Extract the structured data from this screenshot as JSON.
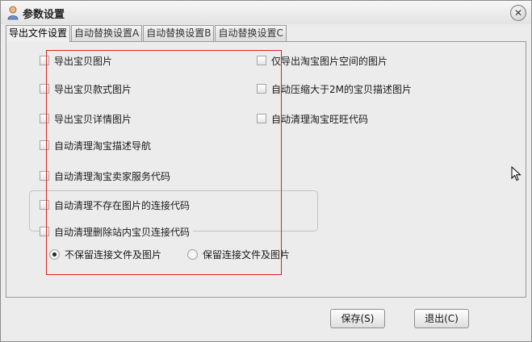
{
  "window": {
    "title": "参数设置",
    "close_glyph": "✕"
  },
  "tabs": [
    {
      "label": "导出文件设置",
      "active": true
    },
    {
      "label": "自动替换设置A",
      "active": false
    },
    {
      "label": "自动替换设置B",
      "active": false
    },
    {
      "label": "自动替换设置C",
      "active": false
    }
  ],
  "options": {
    "left": [
      {
        "label": "导出宝贝图片",
        "checked": false
      },
      {
        "label": "导出宝贝款式图片",
        "checked": false
      },
      {
        "label": "导出宝贝详情图片",
        "checked": false
      },
      {
        "label": "自动清理淘宝描述导航",
        "checked": false
      },
      {
        "label": "自动清理淘宝卖家服务代码",
        "checked": false
      },
      {
        "label": "自动清理不存在图片的连接代码",
        "checked": false
      },
      {
        "label": "自动清理删除站内宝贝连接代码",
        "checked": false
      }
    ],
    "right": [
      {
        "label": "仅导出淘宝图片空间的图片",
        "checked": false
      },
      {
        "label": "自动压缩大于2M的宝贝描述图片",
        "checked": false
      },
      {
        "label": "自动清理淘宝旺旺代码",
        "checked": false
      }
    ]
  },
  "link_mode": {
    "options": [
      {
        "label": "不保留连接文件及图片",
        "selected": true
      },
      {
        "label": "保留连接文件及图片",
        "selected": false
      }
    ]
  },
  "buttons": {
    "save_label": "保存(S)",
    "exit_label": "退出(C)"
  },
  "colors": {
    "highlight_box": "#e02020",
    "window_bg": "#ececec"
  }
}
